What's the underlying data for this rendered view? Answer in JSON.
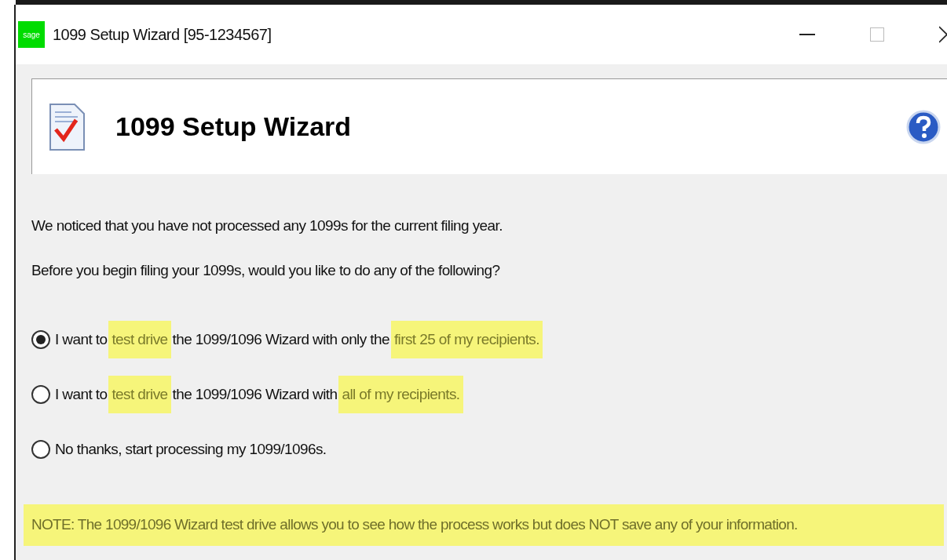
{
  "window": {
    "logo": "sage",
    "title": "1099 Setup Wizard [95-1234567]"
  },
  "header": {
    "title": "1099 Setup Wizard"
  },
  "intro": [
    "We noticed that you have not processed any 1099s for the current filing year.",
    "Before you begin filing your 1099s, would you like to do any of the following?"
  ],
  "options": [
    {
      "selected": true,
      "segments": [
        {
          "text": "I want to",
          "highlighted": false
        },
        {
          "text": "test drive",
          "highlighted": true
        },
        {
          "text": "the 1099/1096 Wizard with only the",
          "highlighted": false
        },
        {
          "text": "first 25 of my recipients.",
          "highlighted": true
        }
      ]
    },
    {
      "selected": false,
      "segments": [
        {
          "text": "I want to",
          "highlighted": false
        },
        {
          "text": "test drive",
          "highlighted": true
        },
        {
          "text": "the 1099/1096 Wizard with",
          "highlighted": false
        },
        {
          "text": "all of my recipients.",
          "highlighted": true
        }
      ]
    },
    {
      "selected": false,
      "segments": [
        {
          "text": "No thanks, start processing my 1099/1096s.",
          "highlighted": false
        }
      ]
    }
  ],
  "note": {
    "text": "NOTE: The 1099/1096 Wizard test drive allows you to see how the process works but does NOT save any of your information.",
    "highlighted": true
  }
}
